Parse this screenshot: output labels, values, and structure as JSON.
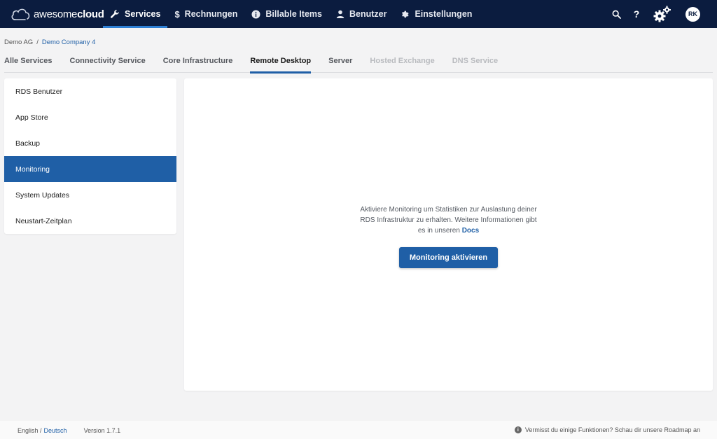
{
  "app": {
    "logo_thin": "awesome",
    "logo_bold": "cloud"
  },
  "nav": {
    "items": [
      {
        "label": "Services",
        "icon": "wrench-icon"
      },
      {
        "label": "Rechnungen",
        "icon": "dollar-icon"
      },
      {
        "label": "Billable Items",
        "icon": "info-icon"
      },
      {
        "label": "Benutzer",
        "icon": "user-icon"
      },
      {
        "label": "Einstellungen",
        "icon": "gear-icon"
      }
    ],
    "active_index": 0
  },
  "topright": {
    "help": "?",
    "avatar_initials": "RK",
    "icons": [
      "search-icon",
      "help-icon",
      "settings-gears-icon",
      "avatar"
    ]
  },
  "breadcrumb": {
    "root": "Demo AG",
    "separator": "/",
    "current": "Demo Company 4"
  },
  "tabs": [
    {
      "label": "Alle Services"
    },
    {
      "label": "Connectivity Service"
    },
    {
      "label": "Core Infrastructure"
    },
    {
      "label": "Remote Desktop",
      "active": true
    },
    {
      "label": "Server"
    },
    {
      "label": "Hosted Exchange",
      "disabled": true
    },
    {
      "label": "DNS Service",
      "disabled": true
    }
  ],
  "sidebar": {
    "items": [
      {
        "label": "RDS Benutzer"
      },
      {
        "label": "App Store"
      },
      {
        "label": "Backup"
      },
      {
        "label": "Monitoring",
        "active": true
      },
      {
        "label": "System Updates"
      },
      {
        "label": "Neustart-Zeitplan"
      }
    ]
  },
  "main": {
    "message": "Aktiviere Monitoring um Statistiken zur Auslastung deiner RDS Infrastruktur zu erhalten. Weitere Informationen gibt es in unseren",
    "docs_link": "Docs",
    "button_label": "Monitoring aktivieren"
  },
  "footer": {
    "lang_en": "English /",
    "lang_de": "Deutsch",
    "version": "Version 1.7.1",
    "roadmap_text": "Vermisst du einige Funktionen? Schau dir unsere Roadmap an"
  },
  "colors": {
    "topbar": "#0b1c3f",
    "accent": "#1f5fa6",
    "nav_active_underline": "#2d7fd4",
    "background": "#f3f3f4"
  }
}
